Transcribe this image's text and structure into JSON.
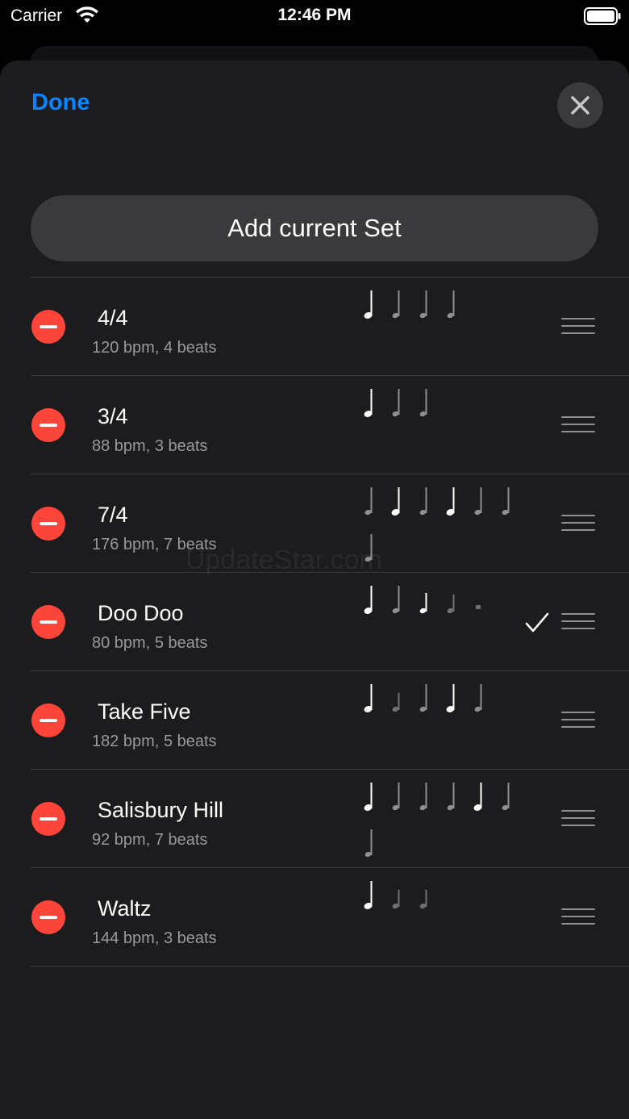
{
  "status_bar": {
    "carrier": "Carrier",
    "time": "12:46 PM"
  },
  "header": {
    "done_label": "Done",
    "close_icon": "close-icon"
  },
  "add_button": {
    "label": "Add current Set"
  },
  "watermark": "UpdateStar.com",
  "colors": {
    "accent": "#0a84ff",
    "delete": "#ff453a",
    "sheet_bg": "#1c1c1e",
    "button_bg": "#3a3a3c",
    "subtitle": "#98989f"
  },
  "items": [
    {
      "title": "4/4",
      "subtitle": "120 bpm, 4 beats",
      "selected": false,
      "beats": [
        "accent",
        "normal",
        "normal",
        "normal"
      ]
    },
    {
      "title": "3/4",
      "subtitle": "88 bpm, 3 beats",
      "selected": false,
      "beats": [
        "accent",
        "normal",
        "normal"
      ]
    },
    {
      "title": "7/4",
      "subtitle": "176 bpm, 7 beats",
      "selected": false,
      "beats": [
        "normal",
        "accent",
        "normal",
        "accent",
        "normal",
        "normal",
        "normal"
      ]
    },
    {
      "title": "Doo Doo",
      "subtitle": "80 bpm, 5 beats",
      "selected": true,
      "beats": [
        "accent",
        "normal",
        "mid",
        "soft",
        "mute"
      ]
    },
    {
      "title": "Take Five",
      "subtitle": "182 bpm, 5 beats",
      "selected": false,
      "beats": [
        "accent",
        "soft",
        "normal",
        "accent",
        "normal"
      ]
    },
    {
      "title": "Salisbury Hill",
      "subtitle": "92 bpm, 7 beats",
      "selected": false,
      "beats": [
        "accent",
        "normal",
        "normal",
        "normal",
        "accent",
        "normal",
        "normal"
      ]
    },
    {
      "title": "Waltz",
      "subtitle": "144 bpm, 3 beats",
      "selected": false,
      "beats": [
        "accent",
        "soft",
        "soft"
      ]
    }
  ]
}
